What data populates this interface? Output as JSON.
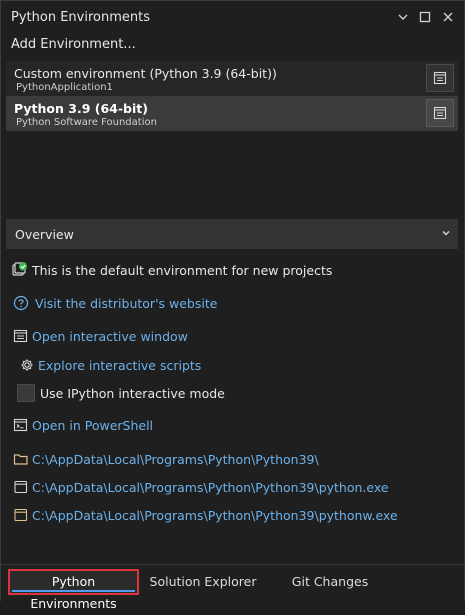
{
  "window": {
    "title": "Python Environments"
  },
  "toolbar": {
    "add_environment": "Add Environment..."
  },
  "environments": [
    {
      "name": "Custom environment (Python 3.9 (64-bit))",
      "subtitle": "PythonApplication1",
      "selected": false
    },
    {
      "name": "Python 3.9 (64-bit)",
      "subtitle": "Python Software Foundation",
      "selected": true
    }
  ],
  "overview": {
    "label": "Overview"
  },
  "details": {
    "default_env": "This is the default environment for new projects",
    "distributor_link": "Visit the distributor's website",
    "open_interactive": "Open interactive window",
    "explore_scripts": "Explore interactive scripts",
    "ipython_mode": "Use IPython interactive mode",
    "open_powershell": "Open in PowerShell",
    "path_folder": "C:\\AppData\\Local\\Programs\\Python\\Python39\\",
    "path_python": "C:\\AppData\\Local\\Programs\\Python\\Python39\\python.exe",
    "path_pythonw": "C:\\AppData\\Local\\Programs\\Python\\Python39\\pythonw.exe"
  },
  "bottom_tabs": [
    {
      "label": "Python Environments",
      "active": true
    },
    {
      "label": "Solution Explorer",
      "active": false
    },
    {
      "label": "Git Changes",
      "active": false
    }
  ],
  "colors": {
    "link": "#6cb2eb",
    "highlight": "#d9363e",
    "active_underline": "#4e9cf5"
  }
}
